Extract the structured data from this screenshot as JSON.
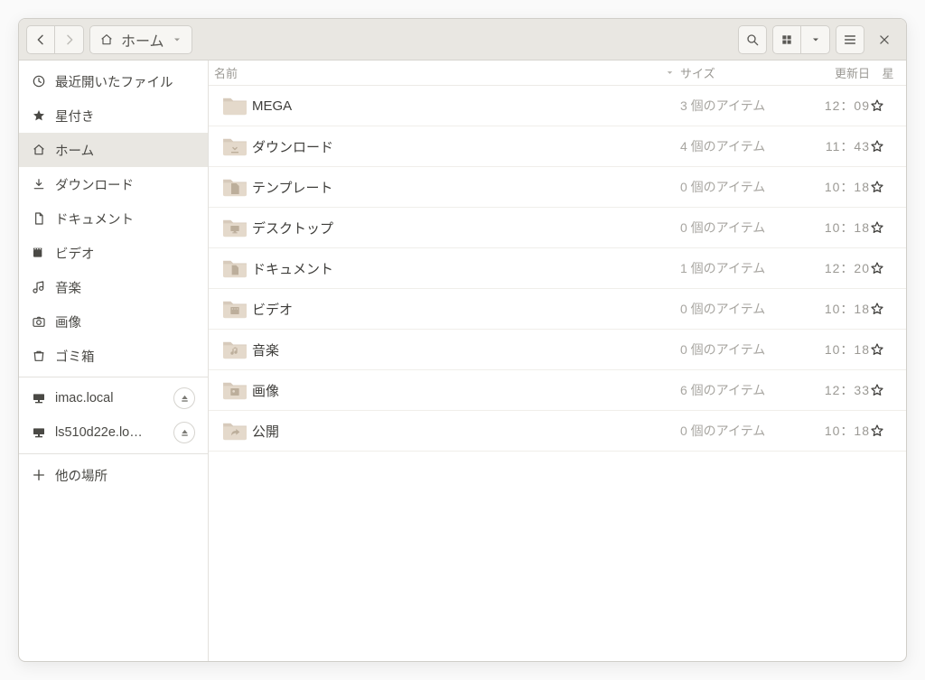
{
  "toolbar": {
    "location_label": "ホーム"
  },
  "columns": {
    "name": "名前",
    "size": "サイズ",
    "date": "更新日",
    "star": "星"
  },
  "sidebar": {
    "places": [
      {
        "icon": "clock",
        "label": "最近開いたファイル"
      },
      {
        "icon": "star",
        "label": "星付き"
      },
      {
        "icon": "home",
        "label": "ホーム",
        "active": true
      },
      {
        "icon": "download",
        "label": "ダウンロード"
      },
      {
        "icon": "document",
        "label": "ドキュメント"
      },
      {
        "icon": "video",
        "label": "ビデオ"
      },
      {
        "icon": "music",
        "label": "音楽"
      },
      {
        "icon": "picture",
        "label": "画像"
      },
      {
        "icon": "trash",
        "label": "ゴミ箱"
      }
    ],
    "network": [
      {
        "label": "imac.local"
      },
      {
        "label": "ls510d22e.lo…"
      }
    ],
    "other": {
      "label": "他の場所"
    }
  },
  "files": [
    {
      "glyph": "",
      "name": "MEGA",
      "size": "3 個のアイテム",
      "date": "12：09"
    },
    {
      "glyph": "download",
      "name": "ダウンロード",
      "size": "4 個のアイテム",
      "date": "11：43"
    },
    {
      "glyph": "template",
      "name": "テンプレート",
      "size": "0 個のアイテム",
      "date": "10：18"
    },
    {
      "glyph": "desktop",
      "name": "デスクトップ",
      "size": "0 個のアイテム",
      "date": "10：18"
    },
    {
      "glyph": "document",
      "name": "ドキュメント",
      "size": "1 個のアイテム",
      "date": "12：20"
    },
    {
      "glyph": "video",
      "name": "ビデオ",
      "size": "0 個のアイテム",
      "date": "10：18"
    },
    {
      "glyph": "music",
      "name": "音楽",
      "size": "0 個のアイテム",
      "date": "10：18"
    },
    {
      "glyph": "picture",
      "name": "画像",
      "size": "6 個のアイテム",
      "date": "12：33"
    },
    {
      "glyph": "share",
      "name": "公開",
      "size": "0 個のアイテム",
      "date": "10：18"
    }
  ]
}
